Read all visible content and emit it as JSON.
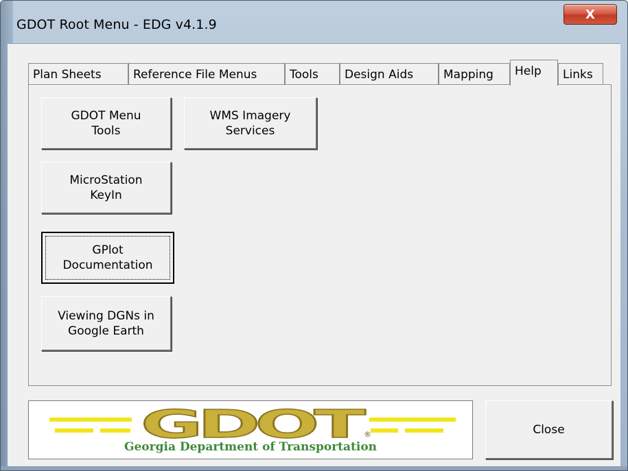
{
  "window": {
    "title": "GDOT Root Menu - EDG v4.1.9",
    "close_glyph": "X"
  },
  "tabs": [
    {
      "label": "Plan Sheets"
    },
    {
      "label": "Reference File Menus"
    },
    {
      "label": "Tools"
    },
    {
      "label": "Design Aids"
    },
    {
      "label": "Mapping"
    },
    {
      "label": "Help"
    },
    {
      "label": "Links"
    }
  ],
  "active_tab": "Help",
  "help_panel": {
    "buttons": {
      "gdot_menu_tools": "GDOT Menu\nTools",
      "wms_imagery": "WMS Imagery\nServices",
      "microstation_keyin": "MicroStation\nKeyIn",
      "gplot_docs": "GPlot\nDocumentation",
      "dgn_google_earth": "Viewing DGNs in\nGoogle Earth"
    }
  },
  "logo": {
    "wordmark": "GDOT",
    "registered": "®",
    "subtitle": "Georgia Department of Transportation",
    "colors": {
      "gold": "#c8b03a",
      "yellow_line": "#f2e51a",
      "green_text": "#3e8a3a"
    }
  },
  "footer": {
    "close_label": "Close"
  },
  "colors": {
    "close_x_bg": "#c94a35",
    "panel_bg": "#f0f0f0"
  }
}
